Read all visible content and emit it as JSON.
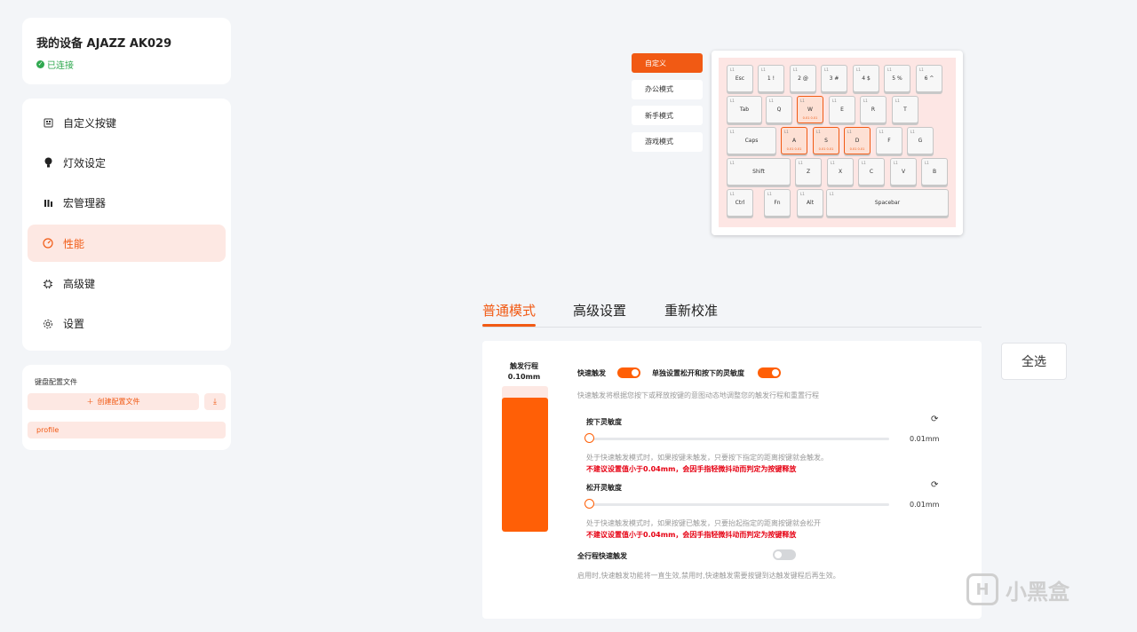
{
  "device": {
    "title": "我的设备 AJAZZ AK029",
    "status": "已连接",
    "status_color": "#2fa84f"
  },
  "nav": {
    "items": [
      {
        "label": "自定义按键",
        "icon": "keymap-icon"
      },
      {
        "label": "灯效设定",
        "icon": "lightbulb-icon"
      },
      {
        "label": "宏管理器",
        "icon": "macro-icon"
      },
      {
        "label": "性能",
        "icon": "performance-icon",
        "active": true
      },
      {
        "label": "高级键",
        "icon": "chip-icon"
      },
      {
        "label": "设置",
        "icon": "gear-icon"
      }
    ]
  },
  "profiles": {
    "title": "键盘配置文件",
    "create_label": "创建配置文件",
    "items": [
      "profile"
    ]
  },
  "modes": [
    "自定义",
    "办公模式",
    "新手模式",
    "游戏模式"
  ],
  "keyboard": {
    "key_level": "L1",
    "selected_sub": "0.01  0.01",
    "rows": [
      [
        "Esc",
        "1 !",
        "2 @",
        "3 #",
        "4 $",
        "5 %",
        "6 ^"
      ],
      [
        "Tab",
        "Q",
        "W",
        "E",
        "R",
        "T"
      ],
      [
        "Caps",
        "A",
        "S",
        "D",
        "F",
        "G"
      ],
      [
        "Shift",
        "Z",
        "X",
        "C",
        "V",
        "B"
      ],
      [
        "Ctrl",
        "Fn",
        "Alt",
        "Spacebar"
      ]
    ],
    "selected": [
      "W",
      "A",
      "S",
      "D"
    ]
  },
  "tabs": [
    "普通模式",
    "高级设置",
    "重新校准"
  ],
  "select_all": "全选",
  "settings": {
    "travel_label": "触发行程",
    "travel_value": "0.10mm",
    "travel_fraction": 0.92,
    "rapid_trigger_label": "快速触发",
    "rapid_trigger_on": true,
    "separate_label": "单独设置松开和按下的灵敏度",
    "separate_on": true,
    "rapid_desc": "快速触发将根据您按下或释放按键的意图动态地调整您的触发行程和重置行程",
    "press": {
      "title": "按下灵敏度",
      "value": "0.01mm",
      "fraction": 0.0,
      "hint": "处于快速触发模式时，如果按键未触发，只要按下指定的距离按键就会触发。",
      "warn": "不建议设置值小于0.04mm，会因手指轻微抖动而判定为按键释放"
    },
    "release": {
      "title": "松开灵敏度",
      "value": "0.01mm",
      "fraction": 0.0,
      "hint": "处于快速触发模式时，如果按键已触发，只要抬起指定的距离按键就会松开",
      "warn": "不建议设置值小于0.04mm，会因手指轻微抖动而判定为按键释放"
    },
    "full_label": "全行程快速触发",
    "full_on": false,
    "full_desc": "启用时,快速触发功能将一直生效,禁用时,快速触发需要按键到达触发键程后再生效。"
  },
  "accent_color": "#f15a14",
  "watermark": "小黑盒"
}
